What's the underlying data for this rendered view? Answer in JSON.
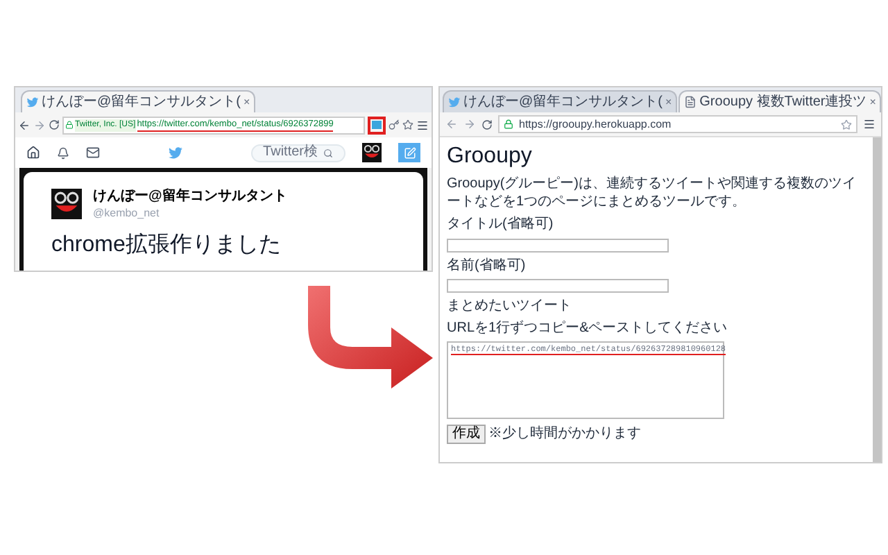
{
  "left_browser": {
    "tab": {
      "title": "けんぼー@留年コンサルタント(",
      "close": "×"
    },
    "address": {
      "security_label": "Twitter, Inc. [US]",
      "url": "https://twitter.com/kembo_net/status/6926372899"
    },
    "extension_highlighted": true,
    "twitter_nav": {
      "search_placeholder": "Twitter検"
    },
    "tweet": {
      "name": "けんぼー@留年コンサルタント",
      "handle": "@kembo_net",
      "text": "chrome拡張作りました"
    }
  },
  "right_browser": {
    "tabs": [
      {
        "title": "けんぼー@留年コンサルタント(",
        "close": "×",
        "selected": false
      },
      {
        "title": "Grooupy 複数Twitter連投ツ",
        "close": "×",
        "selected": true
      }
    ],
    "url": "https://grooupy.herokuapp.com",
    "page": {
      "heading": "Grooupy",
      "description": "Grooupy(グルーピー)は、連続するツイートや関連する複数のツイートなどを1つのページにまとめるツールです。",
      "fields": [
        {
          "kind": "input",
          "label": "タイトル(省略可)"
        },
        {
          "kind": "input",
          "label": "名前(省略可)"
        },
        {
          "kind": "textarea",
          "label": "まとめたいツイート",
          "hint": "URLを1行ずつコピー&ペーストしてください",
          "value": "https://twitter.com/kembo_net/status/692637289810960128"
        }
      ],
      "submit": {
        "label": "作成",
        "note": "※少し時間がかかります"
      }
    }
  }
}
